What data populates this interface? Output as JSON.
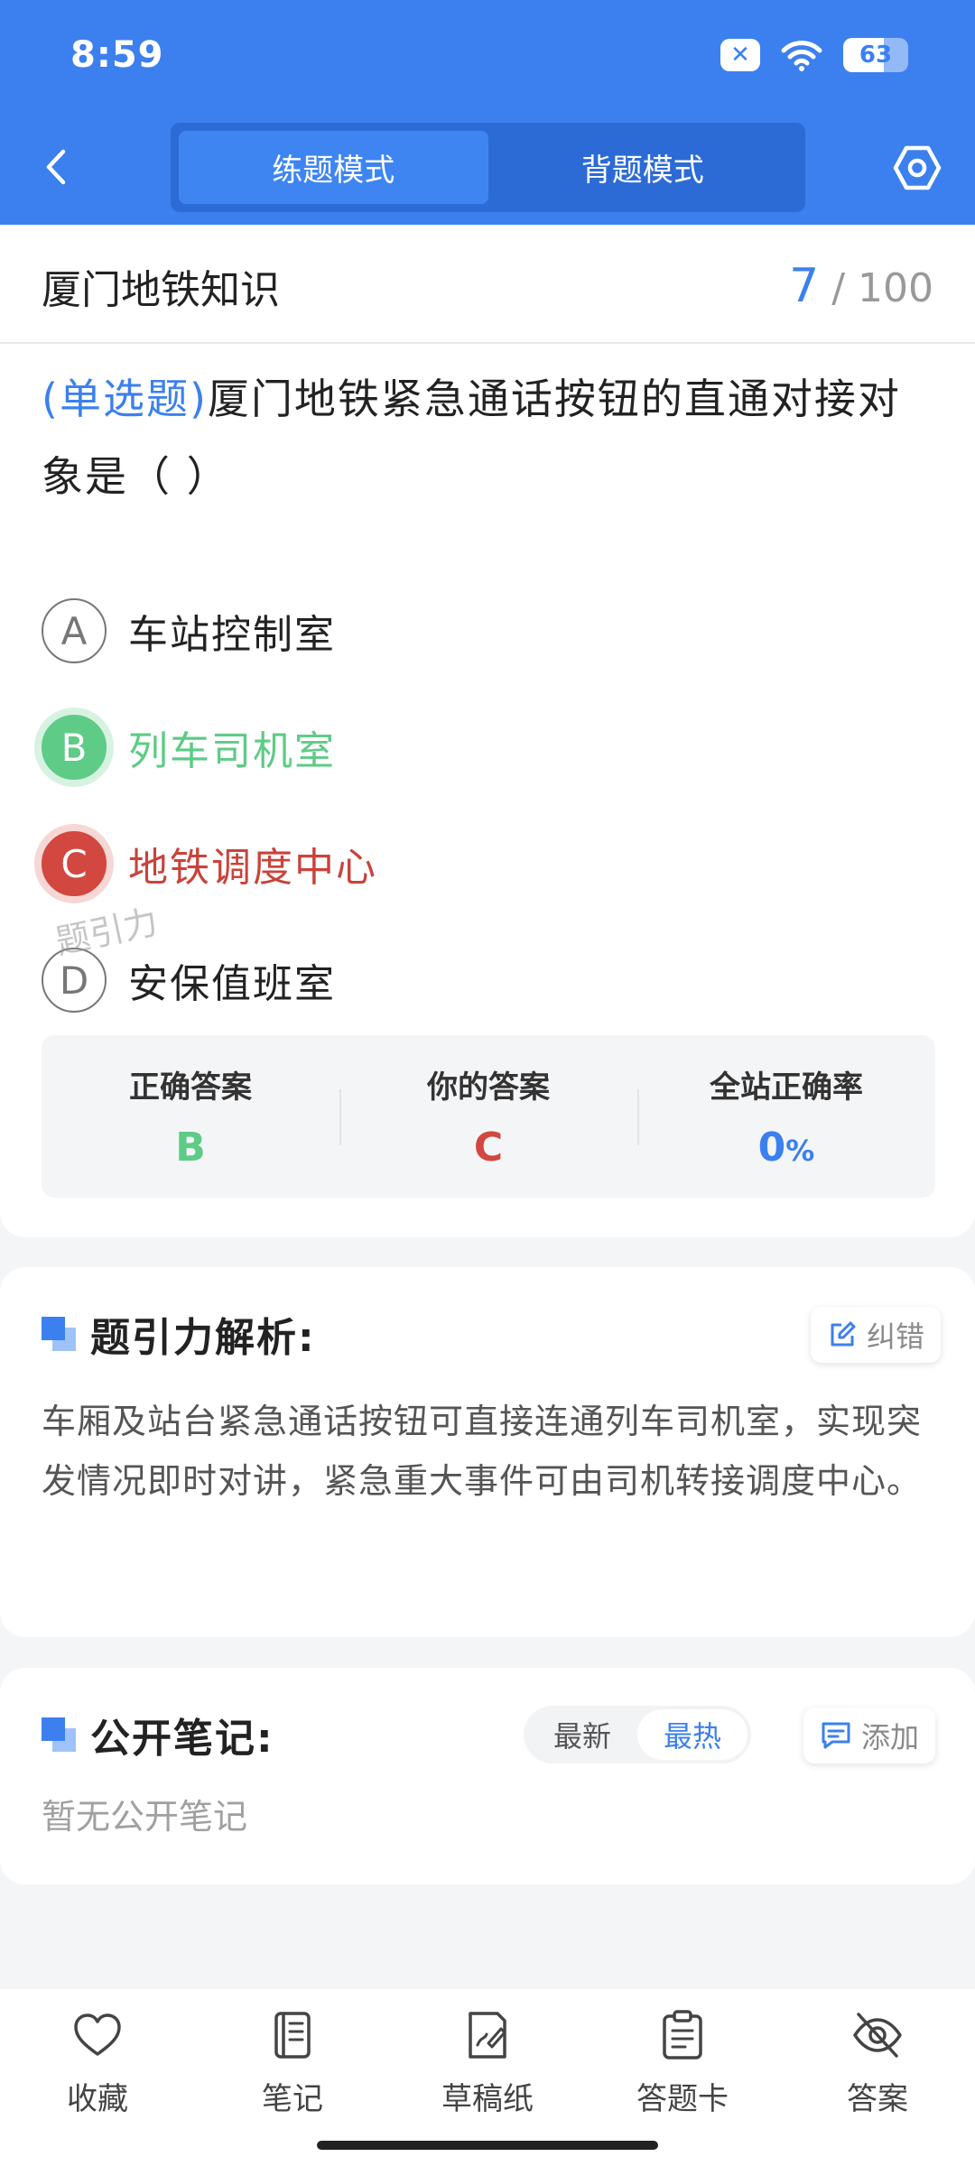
{
  "status_bar": {
    "time": "8:59",
    "battery_level": 63,
    "battery_text": "63"
  },
  "header": {
    "modes": [
      {
        "label": "练题模式",
        "active": true
      },
      {
        "label": "背题模式",
        "active": false
      }
    ],
    "icons": {
      "back": "back-chevron-icon",
      "settings": "settings-hexagon-icon"
    }
  },
  "quiz": {
    "bank_title": "厦门地铁知识",
    "progress": {
      "current": "7",
      "separator": "/",
      "total": "100"
    },
    "question": {
      "type": "(单选题)",
      "text": "厦门地铁紧急通话按钮的直通对接对象是（        ）"
    },
    "options": [
      {
        "letter": "A",
        "text": "车站控制室",
        "state": "normal"
      },
      {
        "letter": "B",
        "text": "列车司机室",
        "state": "correct"
      },
      {
        "letter": "C",
        "text": "地铁调度中心",
        "state": "wrong"
      },
      {
        "letter": "D",
        "text": "安保值班室",
        "state": "normal"
      }
    ],
    "summary": {
      "correct_label": "正确答案",
      "correct_value": "B",
      "yours_label": "你的答案",
      "yours_value": "C",
      "rate_label": "全站正确率",
      "rate_value": "0",
      "rate_unit": "%"
    },
    "watermark": "题引力"
  },
  "analysis": {
    "title": "题引力解析:",
    "report_label": "纠错",
    "text": "车厢及站台紧急通话按钮可直接连通列车司机室，实现突发情况即时对讲，紧急重大事件可由司机转接调度中心。"
  },
  "notes": {
    "title": "公开笔记:",
    "sort_options": [
      {
        "label": "最新",
        "active": false
      },
      {
        "label": "最热",
        "active": true
      }
    ],
    "add_label": "添加",
    "empty_text": "暂无公开笔记"
  },
  "bottom_nav": [
    {
      "label": "收藏",
      "icon": "heart-icon"
    },
    {
      "label": "笔记",
      "icon": "notebook-icon"
    },
    {
      "label": "草稿纸",
      "icon": "draft-paper-icon"
    },
    {
      "label": "答题卡",
      "icon": "answer-sheet-icon"
    },
    {
      "label": "答案",
      "icon": "eye-off-icon"
    }
  ],
  "colors": {
    "primary": "#3b80ee",
    "correct": "#5ecb86",
    "wrong": "#d2473f",
    "background": "#f4f5f7"
  }
}
